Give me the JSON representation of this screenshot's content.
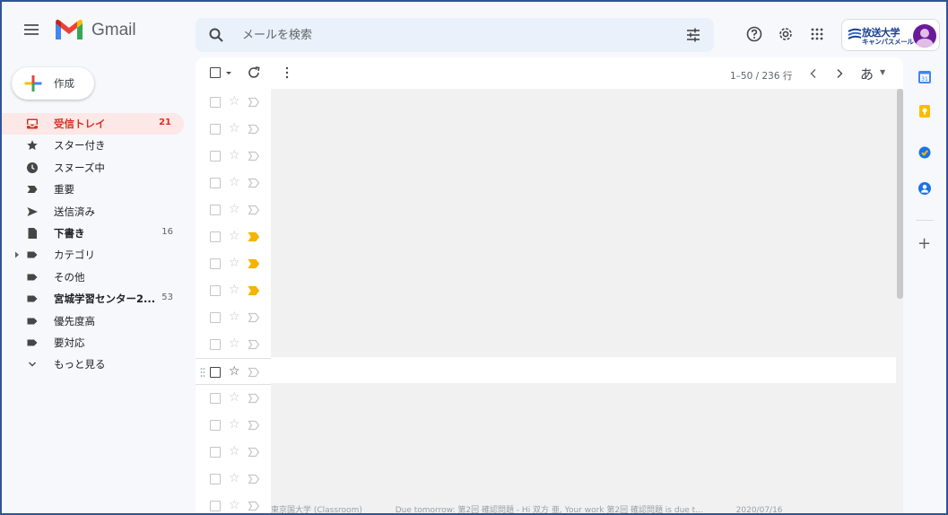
{
  "header": {
    "brand": "Gmail",
    "search_placeholder": "メールを検索",
    "org_name": "放送大学",
    "org_sub": "キャンパスメール"
  },
  "compose": {
    "label": "作成"
  },
  "nav": [
    {
      "label": "受信トレイ",
      "count": "21",
      "icon": "inbox-icon"
    },
    {
      "label": "スター付き",
      "count": "",
      "icon": "star-icon"
    },
    {
      "label": "スヌーズ中",
      "count": "",
      "icon": "clock-icon"
    },
    {
      "label": "重要",
      "count": "",
      "icon": "important-icon"
    },
    {
      "label": "送信済み",
      "count": "",
      "icon": "send-icon"
    },
    {
      "label": "下書き",
      "count": "16",
      "icon": "draft-icon"
    },
    {
      "label": "カテゴリ",
      "count": "",
      "icon": "label-icon"
    },
    {
      "label": "その他",
      "count": "",
      "icon": "label-icon"
    },
    {
      "label": "宮城学習センター2...",
      "count": "53",
      "icon": "label-icon"
    },
    {
      "label": "優先度高",
      "count": "",
      "icon": "label-icon"
    },
    {
      "label": "要対応",
      "count": "",
      "icon": "label-icon"
    },
    {
      "label": "もっと見る",
      "count": "",
      "icon": "chevron-down-icon"
    }
  ],
  "toolbar": {
    "pager": "1–50 / 236 行",
    "ime": "あ"
  },
  "rows": [
    {
      "important": false
    },
    {
      "important": false
    },
    {
      "important": false
    },
    {
      "important": false
    },
    {
      "important": false
    },
    {
      "important": true
    },
    {
      "important": true
    },
    {
      "important": true
    },
    {
      "important": false
    },
    {
      "important": false
    },
    {
      "important": false
    },
    {
      "important": false
    },
    {
      "important": false
    },
    {
      "important": false
    },
    {
      "important": false
    },
    {
      "important": false
    }
  ],
  "bottom_row_ghost": [
    "東京国大学 (Classroom)",
    "Due tomorrow: 第2回 確認問題 - Hi 双方 亜, Your work 第2回 確認問題 is due t...",
    "2020/07/16"
  ],
  "colors": {
    "accent_red": "#d93025",
    "inbox_bg": "#fce8e6",
    "important_yellow": "#f4b400",
    "frame_blue": "#2f5597"
  }
}
